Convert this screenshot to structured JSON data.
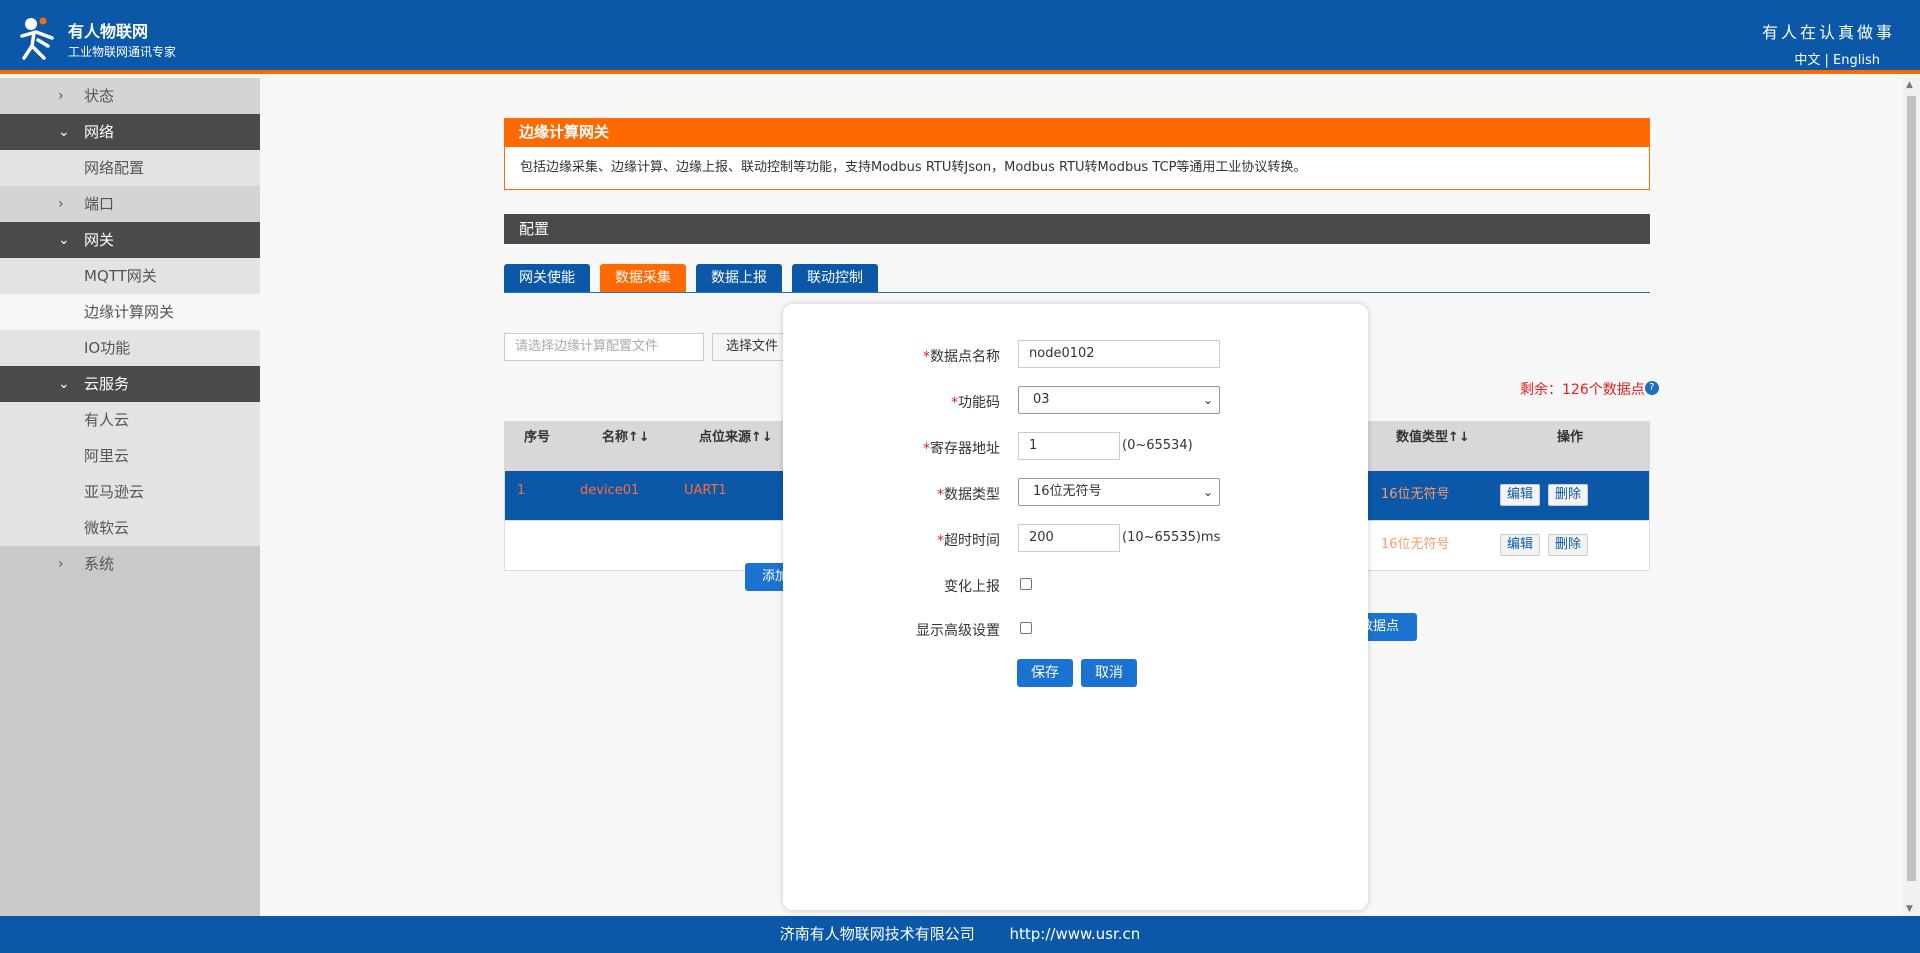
{
  "header": {
    "brand_name": "有人物联网",
    "brand_sub": "工业物联网通讯专家",
    "slogan": "有人在认真做事",
    "lang_zh": "中文",
    "lang_sep": "|",
    "lang_en": "English"
  },
  "sidebar": {
    "items": [
      {
        "label": "状态",
        "chev": "›"
      },
      {
        "label": "网络",
        "chev": "⌄"
      },
      {
        "label": "网络配置"
      },
      {
        "label": "端口",
        "chev": "›"
      },
      {
        "label": "网关",
        "chev": "⌄"
      },
      {
        "label": "MQTT网关"
      },
      {
        "label": "边缘计算网关"
      },
      {
        "label": "IO功能"
      },
      {
        "label": "云服务",
        "chev": "⌄"
      },
      {
        "label": "有人云"
      },
      {
        "label": "阿里云"
      },
      {
        "label": "亚马逊云"
      },
      {
        "label": "微软云"
      },
      {
        "label": "系统",
        "chev": "›"
      }
    ]
  },
  "main": {
    "section_title": "边缘计算网关",
    "section_desc": "包括边缘采集、边缘计算、边缘上报、联动控制等功能，支持Modbus RTU转Json，Modbus RTU转Modbus TCP等通用工业协议转换。",
    "config_title": "配置",
    "tabs": [
      "网关使能",
      "数据采集",
      "数据上报",
      "联动控制"
    ],
    "file_placeholder": "请选择边缘计算配置文件",
    "file_button": "选择文件",
    "remain_text": "剩余：126个数据点",
    "help_glyph": "?",
    "table": {
      "headers": [
        "序号",
        "名称↑↓",
        "点位来源↑↓",
        "数值类型↑↓",
        "操作"
      ],
      "rows": [
        {
          "index": "1",
          "name": "device01",
          "source": "UART1",
          "type": "16位无符号",
          "edit": "编辑",
          "delete": "删除"
        },
        {
          "type": "16位无符号",
          "edit": "编辑",
          "delete": "删除"
        }
      ]
    },
    "add_button_partial": "添加",
    "add_point_partial": "数据点"
  },
  "modal": {
    "required_mark": "*",
    "name_label": "数据点名称",
    "name_value": "node0102",
    "func_label": "功能码",
    "func_value": "03",
    "reg_label": "寄存器地址",
    "reg_value": "1",
    "reg_hint": "(0~65534)",
    "dtype_label": "数据类型",
    "dtype_value": "16位无符号",
    "timeout_label": "超时时间",
    "timeout_value": "200",
    "timeout_hint": "(10~65535)ms",
    "change_report_label": "变化上报",
    "advanced_label": "显示高级设置",
    "save": "保存",
    "cancel": "取消"
  },
  "footer": {
    "company": "济南有人物联网技术有限公司",
    "url": "http://www.usr.cn"
  },
  "colors": {
    "brand_blue": "#0b58a8",
    "accent_orange": "#ff6a00",
    "sidebar_dark": "#4a4a4a"
  }
}
